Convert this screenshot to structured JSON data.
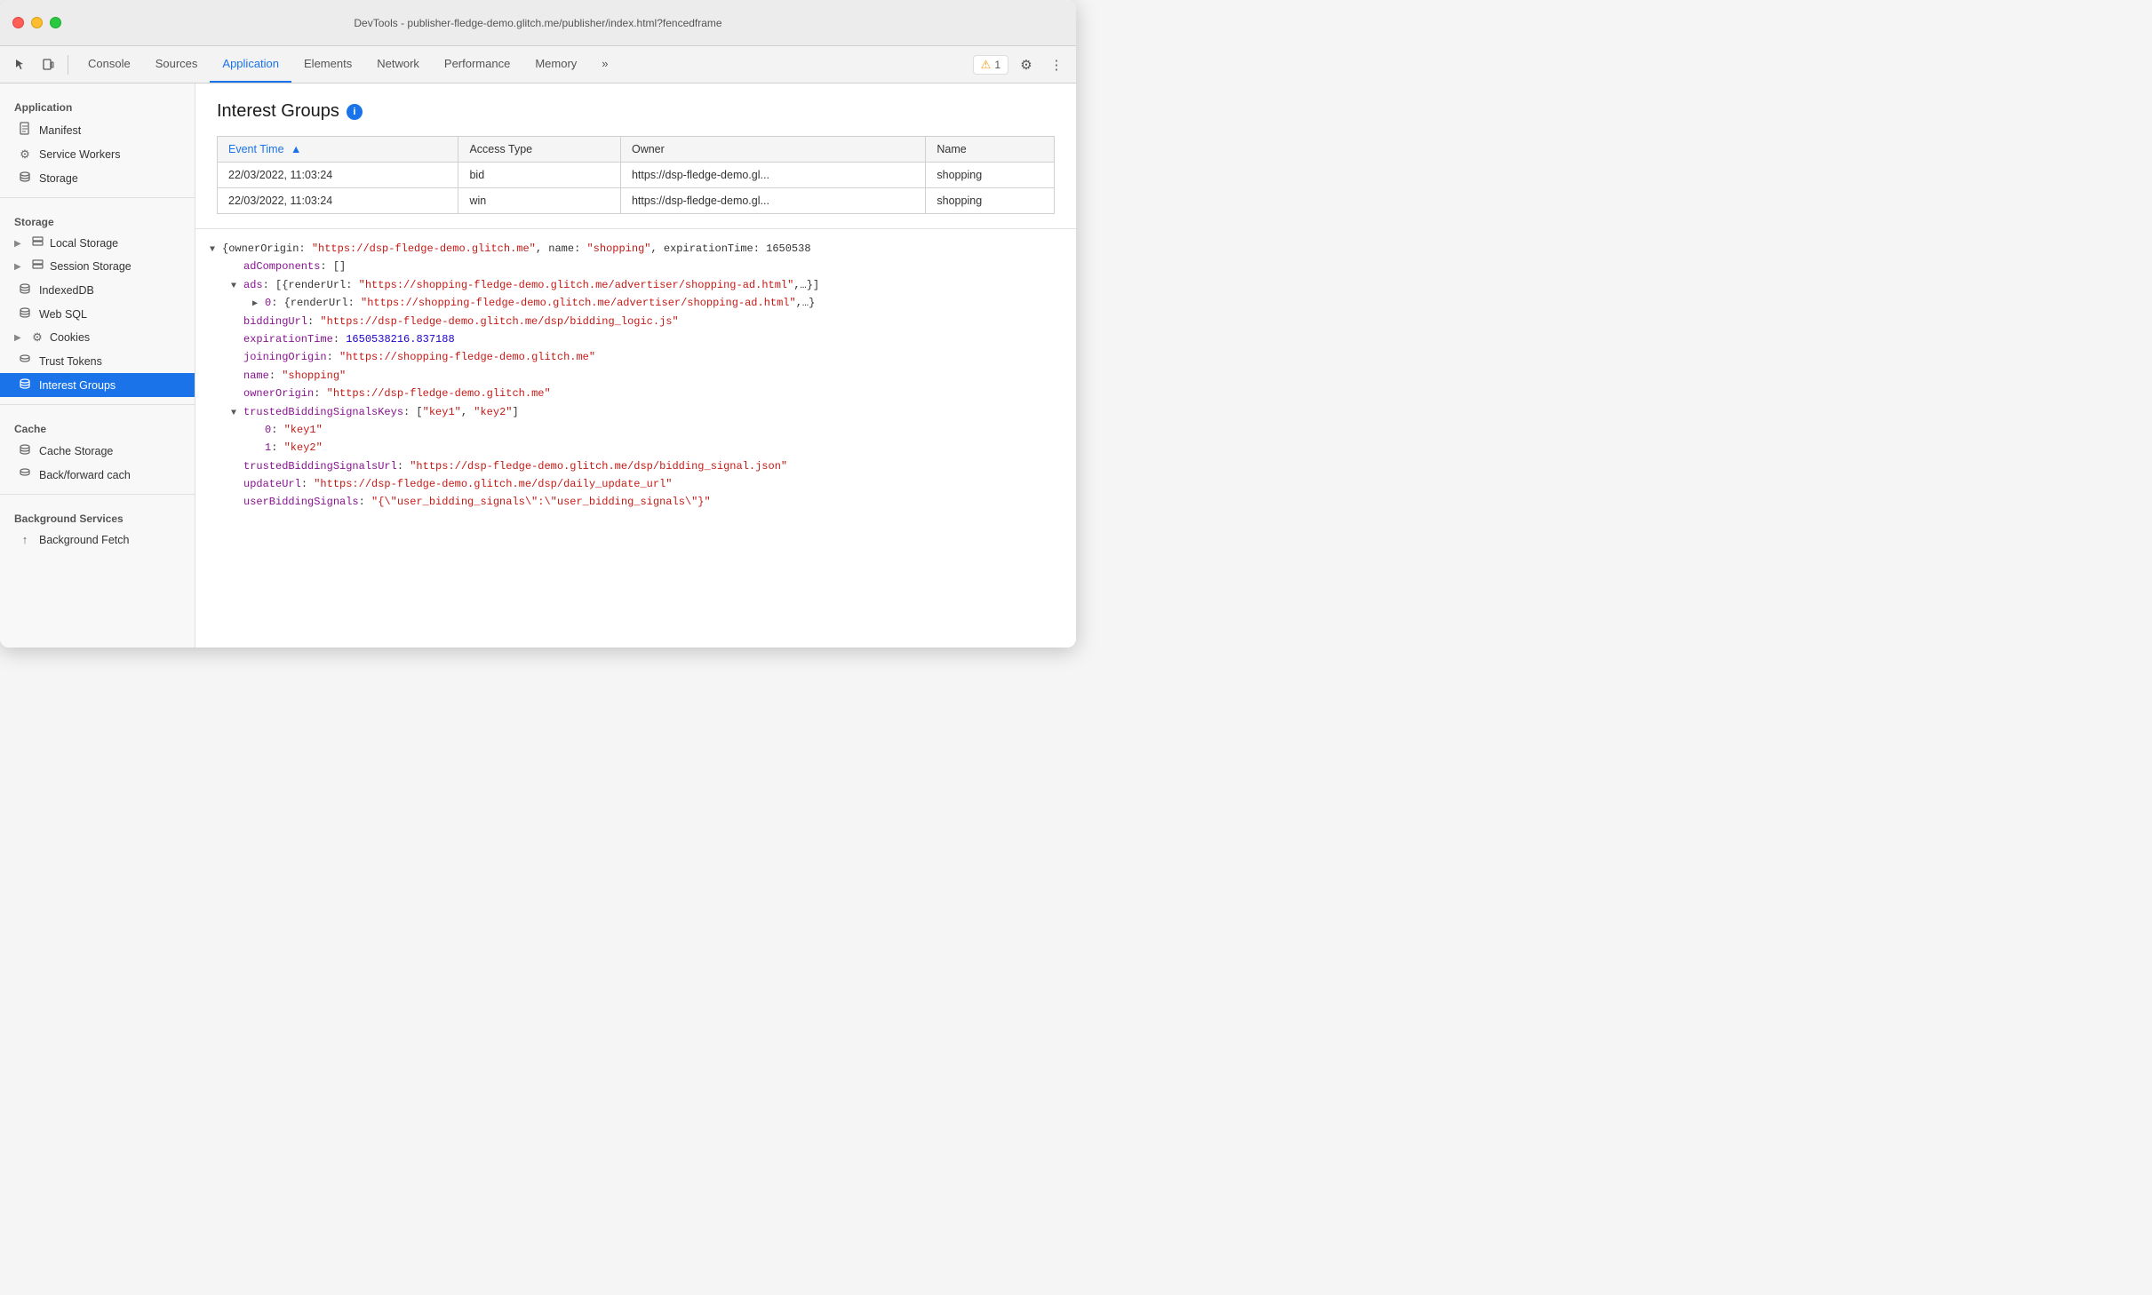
{
  "window": {
    "title": "DevTools - publisher-fledge-demo.glitch.me/publisher/index.html?fencedframe"
  },
  "toolbar": {
    "tabs": [
      {
        "id": "console",
        "label": "Console",
        "active": false
      },
      {
        "id": "sources",
        "label": "Sources",
        "active": false
      },
      {
        "id": "application",
        "label": "Application",
        "active": true
      },
      {
        "id": "elements",
        "label": "Elements",
        "active": false
      },
      {
        "id": "network",
        "label": "Network",
        "active": false
      },
      {
        "id": "performance",
        "label": "Performance",
        "active": false
      },
      {
        "id": "memory",
        "label": "Memory",
        "active": false
      }
    ],
    "more_label": "»",
    "warning_count": "1",
    "settings_icon": "⚙",
    "more_icon": "⋮"
  },
  "sidebar": {
    "sections": [
      {
        "id": "application",
        "title": "Application",
        "items": [
          {
            "id": "manifest",
            "label": "Manifest",
            "icon": "📄",
            "expandable": false,
            "active": false
          },
          {
            "id": "service-workers",
            "label": "Service Workers",
            "icon": "⚙",
            "expandable": false,
            "active": false
          },
          {
            "id": "storage",
            "label": "Storage",
            "icon": "💾",
            "expandable": false,
            "active": false
          }
        ]
      },
      {
        "id": "storage-section",
        "title": "Storage",
        "items": [
          {
            "id": "local-storage",
            "label": "Local Storage",
            "icon": "▦",
            "expandable": true,
            "expanded": false,
            "active": false
          },
          {
            "id": "session-storage",
            "label": "Session Storage",
            "icon": "▦",
            "expandable": true,
            "expanded": false,
            "active": false
          },
          {
            "id": "indexeddb",
            "label": "IndexedDB",
            "icon": "💾",
            "expandable": false,
            "active": false
          },
          {
            "id": "web-sql",
            "label": "Web SQL",
            "icon": "💾",
            "expandable": false,
            "active": false
          },
          {
            "id": "cookies",
            "label": "Cookies",
            "icon": "🍪",
            "expandable": true,
            "expanded": false,
            "active": false
          },
          {
            "id": "trust-tokens",
            "label": "Trust Tokens",
            "icon": "💾",
            "expandable": false,
            "active": false
          },
          {
            "id": "interest-groups",
            "label": "Interest Groups",
            "icon": "💾",
            "expandable": false,
            "active": true
          }
        ]
      },
      {
        "id": "cache-section",
        "title": "Cache",
        "items": [
          {
            "id": "cache-storage",
            "label": "Cache Storage",
            "icon": "💾",
            "expandable": false,
            "active": false
          },
          {
            "id": "back-forward",
            "label": "Back/forward cach",
            "icon": "💾",
            "expandable": false,
            "active": false
          }
        ]
      },
      {
        "id": "background-services",
        "title": "Background Services",
        "items": [
          {
            "id": "background-fetch",
            "label": "Background Fetch",
            "icon": "↑",
            "expandable": false,
            "active": false
          }
        ]
      }
    ]
  },
  "interest_groups": {
    "title": "Interest Groups",
    "info_tooltip": "i",
    "table": {
      "columns": [
        {
          "id": "event_time",
          "label": "Event Time",
          "sorted": true,
          "sort_dir": "asc"
        },
        {
          "id": "access_type",
          "label": "Access Type",
          "sorted": false
        },
        {
          "id": "owner",
          "label": "Owner",
          "sorted": false
        },
        {
          "id": "name",
          "label": "Name",
          "sorted": false
        }
      ],
      "rows": [
        {
          "event_time": "22/03/2022, 11:03:24",
          "access_type": "bid",
          "owner": "https://dsp-fledge-demo.gl...",
          "name": "shopping"
        },
        {
          "event_time": "22/03/2022, 11:03:24",
          "access_type": "win",
          "owner": "https://dsp-fledge-demo.gl...",
          "name": "shopping"
        }
      ]
    }
  },
  "detail": {
    "lines": [
      {
        "indent": 0,
        "triangle": "open",
        "content": "{ownerOrigin: \"https://dsp-fledge-demo.glitch.me\", name: \"shopping\", expirationTime: 1650538",
        "type": "plain"
      },
      {
        "indent": 1,
        "triangle": "none",
        "key": "adComponents",
        "value": "[]",
        "type": "key-value"
      },
      {
        "indent": 1,
        "triangle": "open",
        "key": "ads",
        "value": "[{renderUrl: \"https://shopping-fledge-demo.glitch.me/advertiser/shopping-ad.html\",…}]",
        "type": "key-value-plain"
      },
      {
        "indent": 2,
        "triangle": "closed",
        "key": "0",
        "value": "{renderUrl: \"https://shopping-fledge-demo.glitch.me/advertiser/shopping-ad.html\",…}",
        "type": "key-value-plain"
      },
      {
        "indent": 1,
        "triangle": "none",
        "key": "biddingUrl",
        "value": "\"https://dsp-fledge-demo.glitch.me/dsp/bidding_logic.js\"",
        "type": "key-url"
      },
      {
        "indent": 1,
        "triangle": "none",
        "key": "expirationTime",
        "value": "1650538216.837188",
        "type": "key-number"
      },
      {
        "indent": 1,
        "triangle": "none",
        "key": "joiningOrigin",
        "value": "\"https://shopping-fledge-demo.glitch.me\"",
        "type": "key-url"
      },
      {
        "indent": 1,
        "triangle": "none",
        "key": "name",
        "value": "\"shopping\"",
        "type": "key-string"
      },
      {
        "indent": 1,
        "triangle": "none",
        "key": "ownerOrigin",
        "value": "\"https://dsp-fledge-demo.glitch.me\"",
        "type": "key-url"
      },
      {
        "indent": 1,
        "triangle": "open",
        "key": "trustedBiddingSignalsKeys",
        "value": "[\"key1\", \"key2\"]",
        "type": "key-value-plain"
      },
      {
        "indent": 2,
        "triangle": "none",
        "key": "0",
        "value": "\"key1\"",
        "type": "key-string"
      },
      {
        "indent": 2,
        "triangle": "none",
        "key": "1",
        "value": "\"key2\"",
        "type": "key-string"
      },
      {
        "indent": 1,
        "triangle": "none",
        "key": "trustedBiddingSignalsUrl",
        "value": "\"https://dsp-fledge-demo.glitch.me/dsp/bidding_signal.json\"",
        "type": "key-url"
      },
      {
        "indent": 1,
        "triangle": "none",
        "key": "updateUrl",
        "value": "\"https://dsp-fledge-demo.glitch.me/dsp/daily_update_url\"",
        "type": "key-url"
      },
      {
        "indent": 1,
        "triangle": "none",
        "key": "userBiddingSignals",
        "value": "\"{\\\"user_bidding_signals\\\":\\\"user_bidding_signals\\\"}\"",
        "type": "key-string"
      }
    ]
  }
}
